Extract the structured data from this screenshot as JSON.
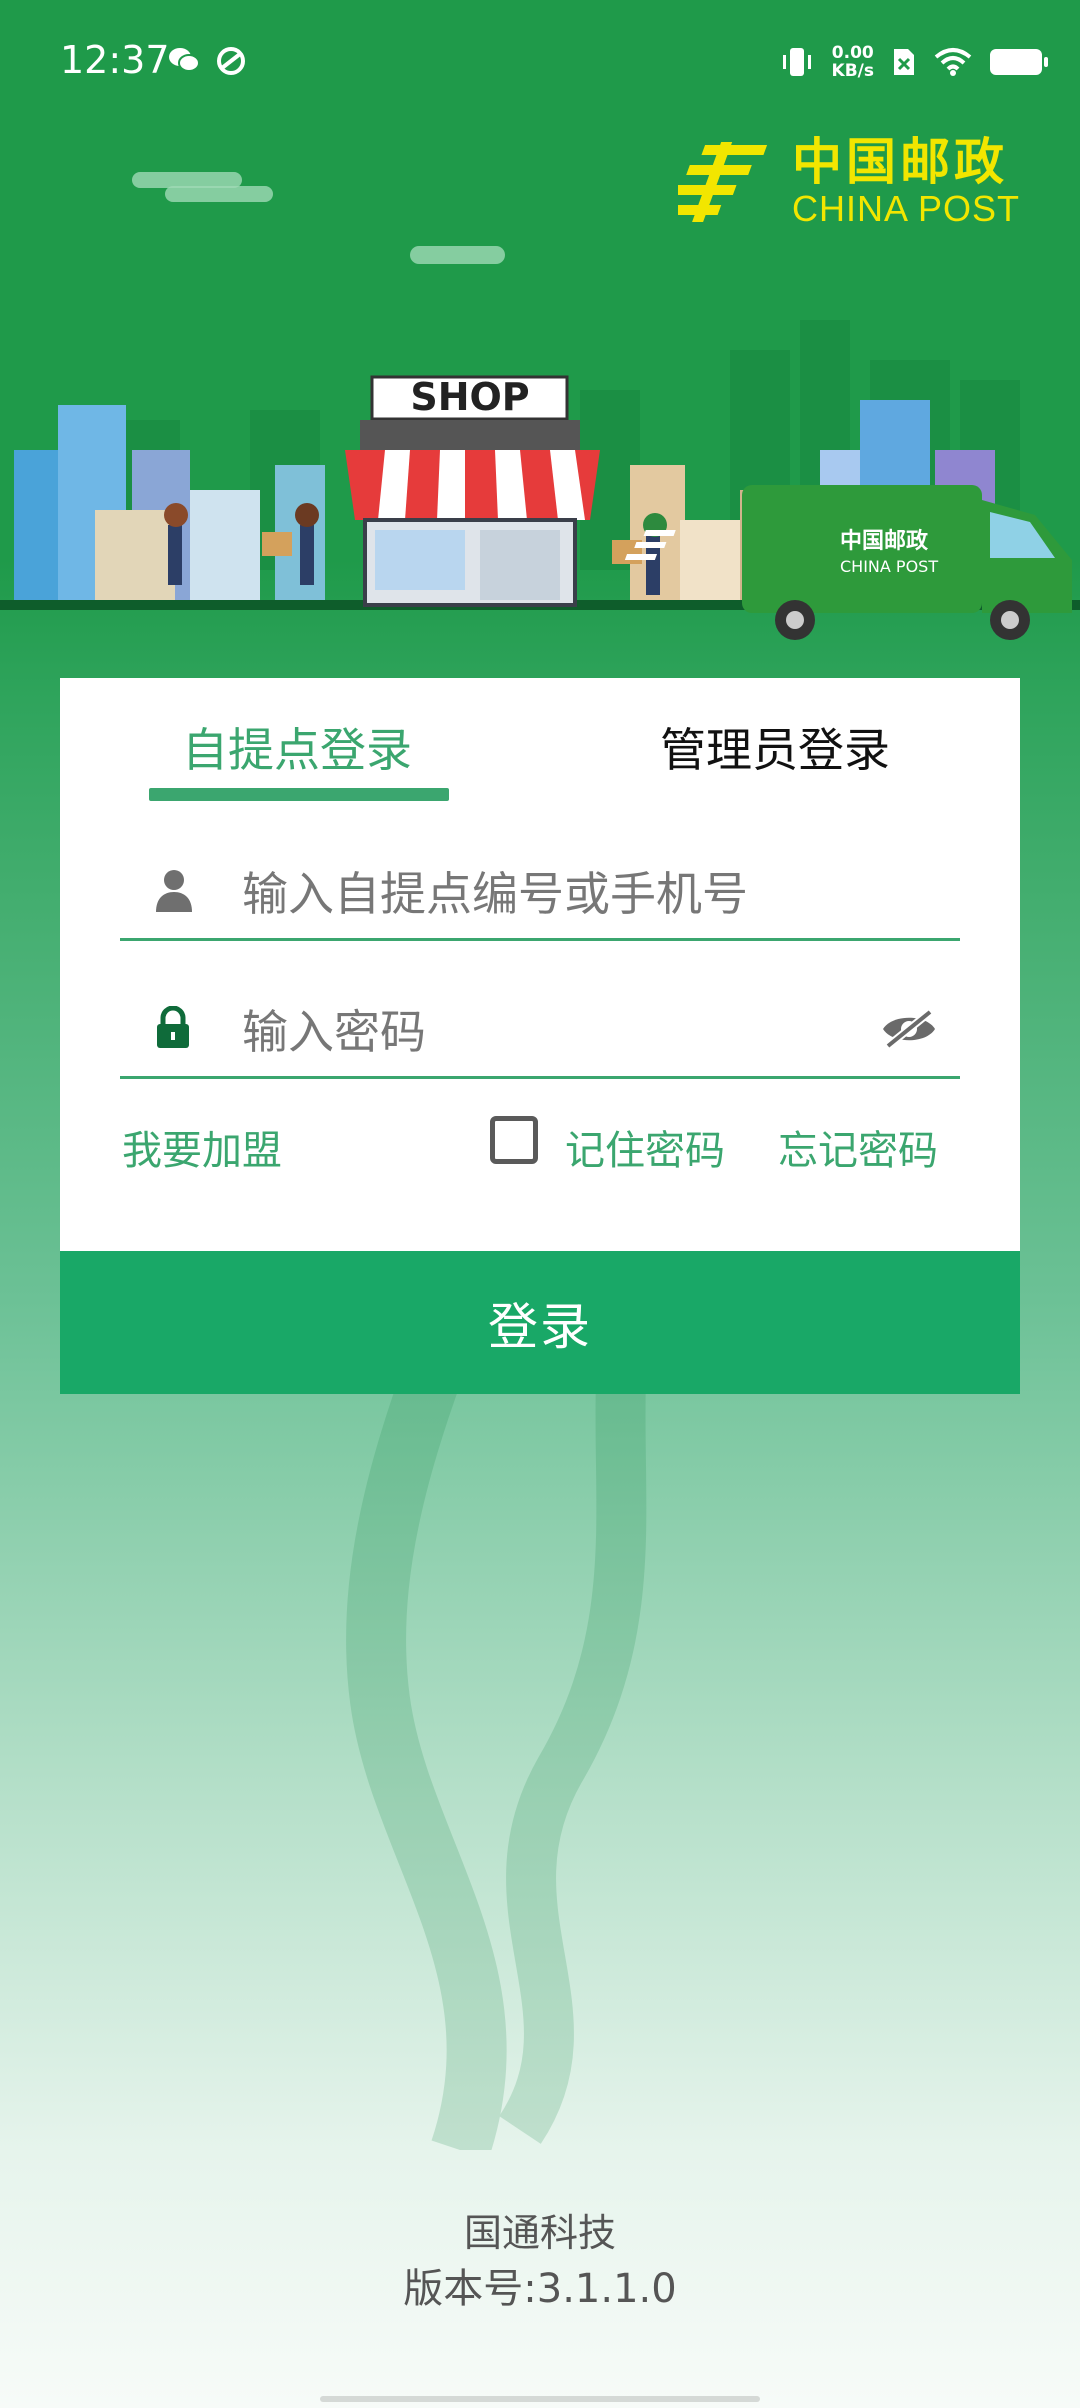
{
  "status_bar": {
    "time": "12:37",
    "net_speed_value": "0.00",
    "net_speed_unit": "KB/s"
  },
  "logo": {
    "cn": "中国邮政",
    "en": "CHINA POST"
  },
  "hero": {
    "shop_sign": "SHOP",
    "truck_cn": "中国邮政",
    "truck_en": "CHINA POST"
  },
  "tabs": {
    "pickup_login": "自提点登录",
    "admin_login": "管理员登录"
  },
  "form": {
    "account_placeholder": "输入自提点编号或手机号",
    "password_placeholder": "输入密码",
    "join_label": "我要加盟",
    "remember_label": "记住密码",
    "forgot_label": "忘记密码",
    "login_label": "登录"
  },
  "footer": {
    "company": "国通科技",
    "version": "版本号:3.1.1.0"
  },
  "colors": {
    "brand_green": "#19a867",
    "accent_green": "#3ba66f",
    "logo_yellow": "#f2e600"
  }
}
